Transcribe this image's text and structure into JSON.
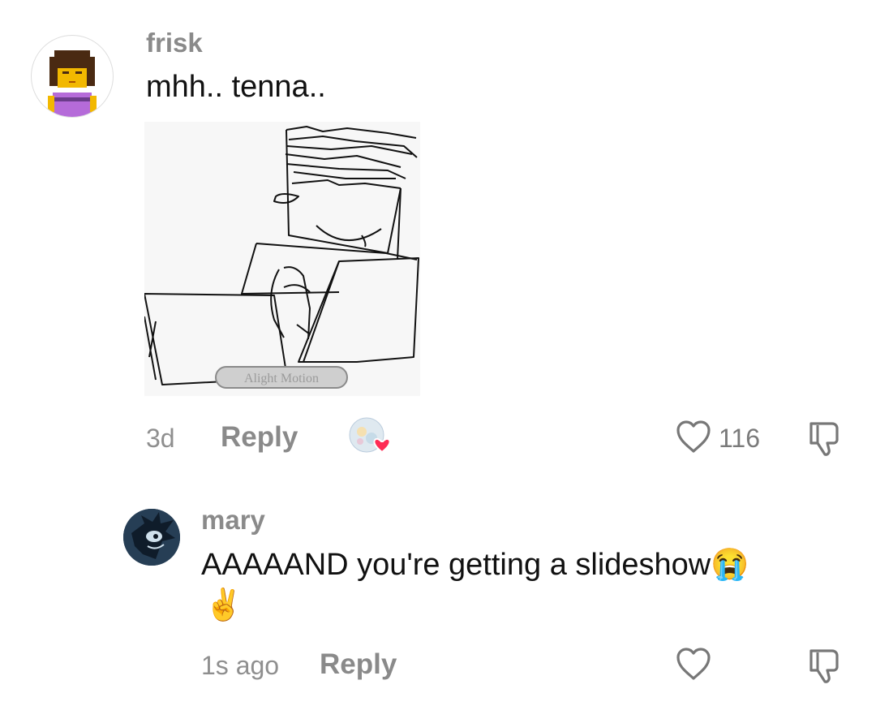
{
  "comments": [
    {
      "username": "frisk",
      "text": "mhh.. tenna..",
      "image_watermark": "Alight Motion",
      "time": "3d",
      "reply_label": "Reply",
      "like_count": "116",
      "avatar_icon": "pixel-character-avatar",
      "creator_liked_icon": "creator-liked-heart-icon"
    },
    {
      "username": "mary",
      "text": "AAAAAND you're getting a slideshow😭",
      "text_line2": "✌️",
      "time": "1s ago",
      "reply_label": "Reply",
      "avatar_icon": "dark-hedgehog-avatar"
    }
  ],
  "colors": {
    "heart_red": "#fe2c55",
    "muted": "#8a8a8a"
  }
}
